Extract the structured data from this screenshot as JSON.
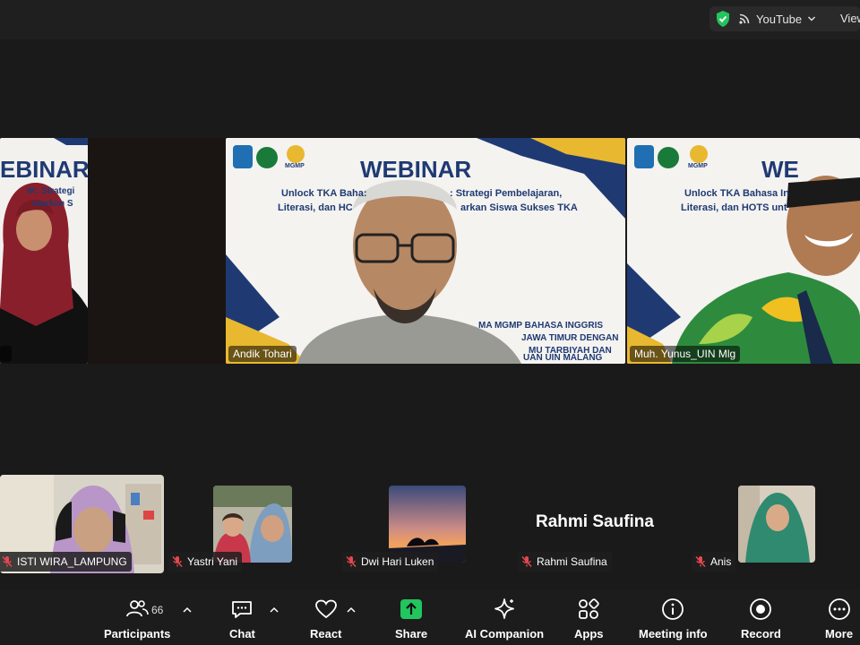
{
  "topbar": {
    "stream_label": "YouTube",
    "view_label": "View"
  },
  "tiles": {
    "left": {
      "banner": "EBINAR",
      "line1": "IK: Strategi",
      "line2": "ntarkan S"
    },
    "center": {
      "banner": "WEBINAR",
      "line1": "Unlock TKA Baha:",
      "line1b": ": Strategi Pembelajaran,",
      "line2": "Literasi, dan HC",
      "line2b": "arkan Siswa Sukses TKA",
      "footer1": "MA MGMP BAHASA INGGRIS",
      "footer2": "JAWA TIMUR DENGAN",
      "footer3": "MU TARBIYAH DAN",
      "footer4": "UAN UIN MALANG",
      "name": "Andik Tohari",
      "logo_text": "MGMP"
    },
    "right": {
      "banner": "WE",
      "line1": "Unlock TKA Bahasa In",
      "line2": "Literasi, dan HOTS unt",
      "name": "Muh. Yunus_UIN Mlg",
      "logo_text": "MGMP"
    }
  },
  "participants_strip": [
    {
      "name": "ISTI WIRA_LAMPUNG"
    },
    {
      "name": "Yastri Yani"
    },
    {
      "name": "Dwi Hari Luken"
    },
    {
      "name": "Rahmi Saufina",
      "display": "Rahmi Saufina"
    },
    {
      "name": "Anis"
    }
  ],
  "toolbar": {
    "participants_label": "Participants",
    "participants_count": "66",
    "chat_label": "Chat",
    "react_label": "React",
    "share_label": "Share",
    "ai_label": "AI Companion",
    "apps_label": "Apps",
    "meeting_info_label": "Meeting info",
    "record_label": "Record",
    "more_label": "More"
  },
  "colors": {
    "share_green": "#22c55e",
    "active_border": "#3ddc84",
    "shield_green": "#22c55e",
    "navy": "#1f3a73",
    "gold": "#e8b830"
  }
}
